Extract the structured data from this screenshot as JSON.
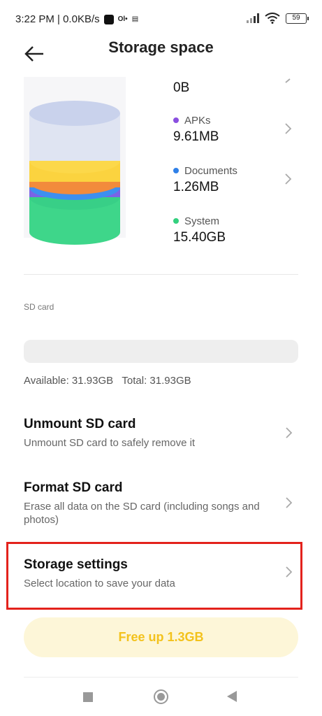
{
  "status_bar": {
    "time_info": "3:22 PM | 0.0KB/s",
    "battery": "59"
  },
  "header": {
    "title": "Storage space"
  },
  "legend": [
    {
      "name": "",
      "value": "0B",
      "color": ""
    },
    {
      "name": "APKs",
      "value": "9.61MB",
      "color": "#8a4fe0"
    },
    {
      "name": "Documents",
      "value": "1.26MB",
      "color": "#2f80e8"
    },
    {
      "name": "System",
      "value": "15.40GB",
      "color": "#33d07e"
    }
  ],
  "sd_card": {
    "section_label": "SD card",
    "available_label": "Available: 31.93GB",
    "total_label": "Total: 31.93GB"
  },
  "rows": [
    {
      "title": "Unmount SD card",
      "description": "Unmount SD card to safely remove it"
    },
    {
      "title": "Format SD card",
      "description": "Erase all data on the SD card (including songs and photos)"
    },
    {
      "title": "Storage settings",
      "description": "Select location to save your data"
    }
  ],
  "free_up_button": "Free up 1.3GB",
  "colors": {
    "highlight": "#e3221c",
    "free_button_bg": "#fdf6d8",
    "free_button_text": "#f3c21c"
  }
}
